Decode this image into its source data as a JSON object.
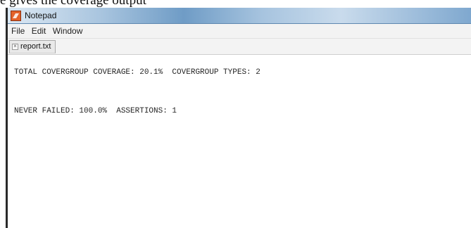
{
  "caption": "e gives the coverage output",
  "window": {
    "title": "Notepad",
    "icon": "notepad-app-icon"
  },
  "menu": [
    {
      "label": "File"
    },
    {
      "label": "Edit"
    },
    {
      "label": "Window"
    }
  ],
  "tab": {
    "label": "report.txt",
    "close_glyph": "×"
  },
  "editor": {
    "lines": [
      "TOTAL COVERGROUP COVERAGE: 20.1%  COVERGROUP TYPES: 2",
      "NEVER FAILED: 100.0%  ASSERTIONS: 1"
    ]
  },
  "colors": {
    "titlebar_accent": "#6f9cc6",
    "app_icon": "#e4622a",
    "frame": "#2a2a2a"
  }
}
